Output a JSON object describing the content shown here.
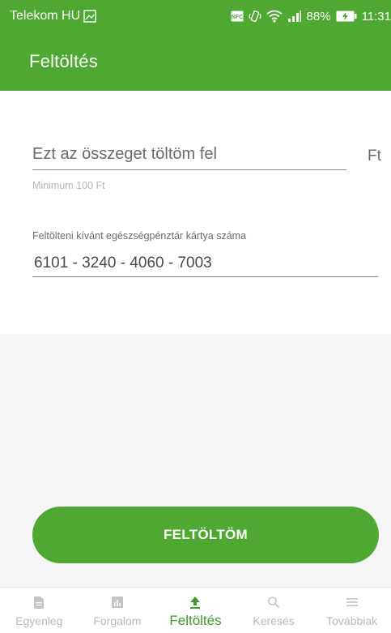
{
  "status_bar": {
    "carrier": "Telekom HU",
    "battery": "88%",
    "time": "11:31",
    "icons": [
      "image-icon",
      "nfc-icon",
      "vibrate-icon",
      "wifi-icon",
      "signal-icon",
      "battery-charging-icon"
    ]
  },
  "header": {
    "title": "Feltöltés"
  },
  "form": {
    "amount": {
      "placeholder": "Ezt az összeget töltöm fel",
      "value": "",
      "currency": "Ft",
      "hint": "Minimum 100 Ft"
    },
    "card": {
      "label": "Feltölteni kívánt egészségpénztár kártya száma",
      "value": "6101 - 3240 - 4060 - 7003"
    },
    "submit_label": "FELTÖLTÖM"
  },
  "bottom_nav": {
    "items": [
      {
        "label": "Egyenleg",
        "icon": "document-icon",
        "active": false
      },
      {
        "label": "Forgalom",
        "icon": "chart-icon",
        "active": false
      },
      {
        "label": "Feltöltés",
        "icon": "upload-icon",
        "active": true
      },
      {
        "label": "Keresés",
        "icon": "search-icon",
        "active": false
      },
      {
        "label": "Továbbiak",
        "icon": "menu-icon",
        "active": false
      }
    ]
  },
  "colors": {
    "brand_green": "#4ea832",
    "active_nav": "#3e9b25",
    "inactive_nav": "#b9b9b9"
  }
}
